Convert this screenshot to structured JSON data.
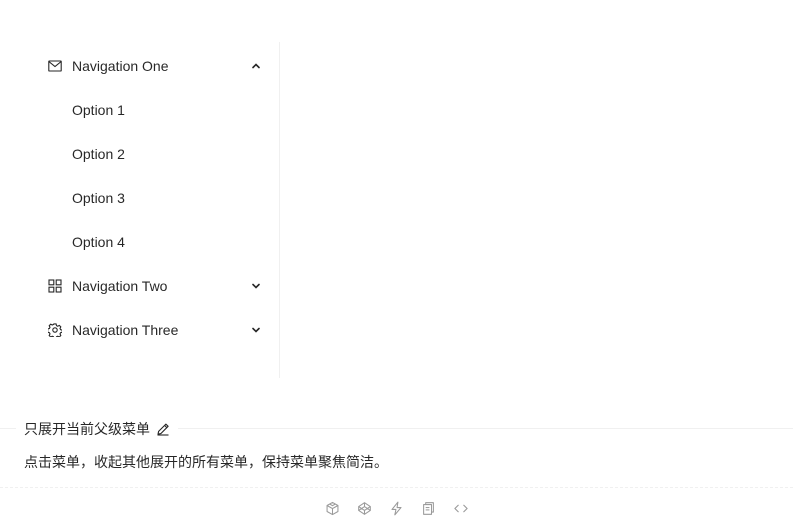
{
  "menu": {
    "nav_one": {
      "label": "Navigation One",
      "icon": "mail-icon",
      "expanded": true,
      "options": [
        "Option 1",
        "Option 2",
        "Option 3",
        "Option 4"
      ]
    },
    "nav_two": {
      "label": "Navigation Two",
      "icon": "appstore-icon",
      "expanded": false
    },
    "nav_three": {
      "label": "Navigation Three",
      "icon": "setting-icon",
      "expanded": false
    }
  },
  "meta": {
    "title": "只展开当前父级菜单",
    "description": "点击菜单，收起其他展开的所有菜单，保持菜单聚焦简洁。"
  },
  "actions": [
    {
      "name": "codesandbox-icon"
    },
    {
      "name": "codepen-icon"
    },
    {
      "name": "stackblitz-icon"
    },
    {
      "name": "copy-icon"
    },
    {
      "name": "expand-code-icon"
    }
  ],
  "colors": {
    "text": "#262626",
    "border": "#f0f0f0",
    "action_icon": "#9a9a9a"
  }
}
